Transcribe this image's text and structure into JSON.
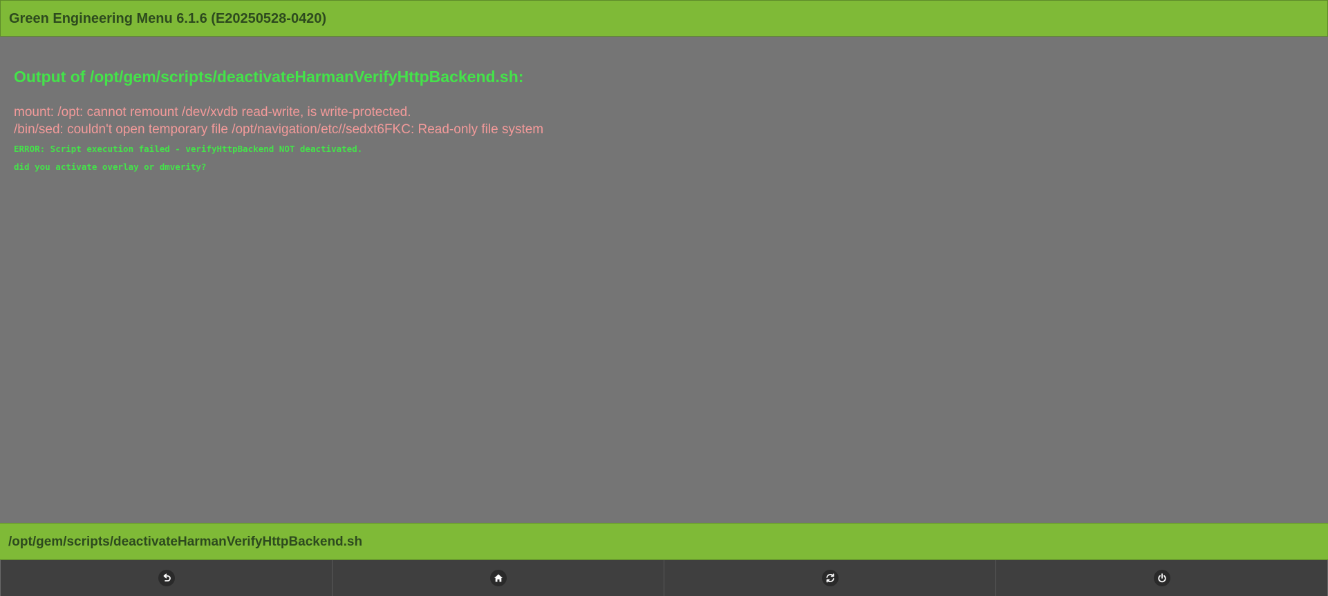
{
  "header": {
    "title": "Green Engineering Menu 6.1.6 (E20250528-0420)"
  },
  "output": {
    "heading": "Output of /opt/gem/scripts/deactivateHarmanVerifyHttpBackend.sh:",
    "error_lines": [
      "mount: /opt: cannot remount /dev/xvdb read-write, is write-protected.",
      "/bin/sed: couldn't open temporary file /opt/navigation/etc//sedxt6FKC: Read-only file system"
    ],
    "status_lines": [
      "ERROR: Script execution failed - verifyHttpBackend NOT deactivated.",
      "did you activate overlay or dmverity?"
    ]
  },
  "statusbar": {
    "path": "/opt/gem/scripts/deactivateHarmanVerifyHttpBackend.sh"
  },
  "toolbar": {
    "buttons": [
      {
        "icon": "back-icon"
      },
      {
        "icon": "home-icon"
      },
      {
        "icon": "refresh-icon"
      },
      {
        "icon": "power-icon"
      }
    ]
  },
  "colors": {
    "header_bg": "#7fba37",
    "header_text": "#2d4a1e",
    "content_bg": "#757575",
    "heading_green": "#44e34a",
    "error_red": "#f39a9a",
    "toolbar_bg": "#3f3f3f"
  }
}
